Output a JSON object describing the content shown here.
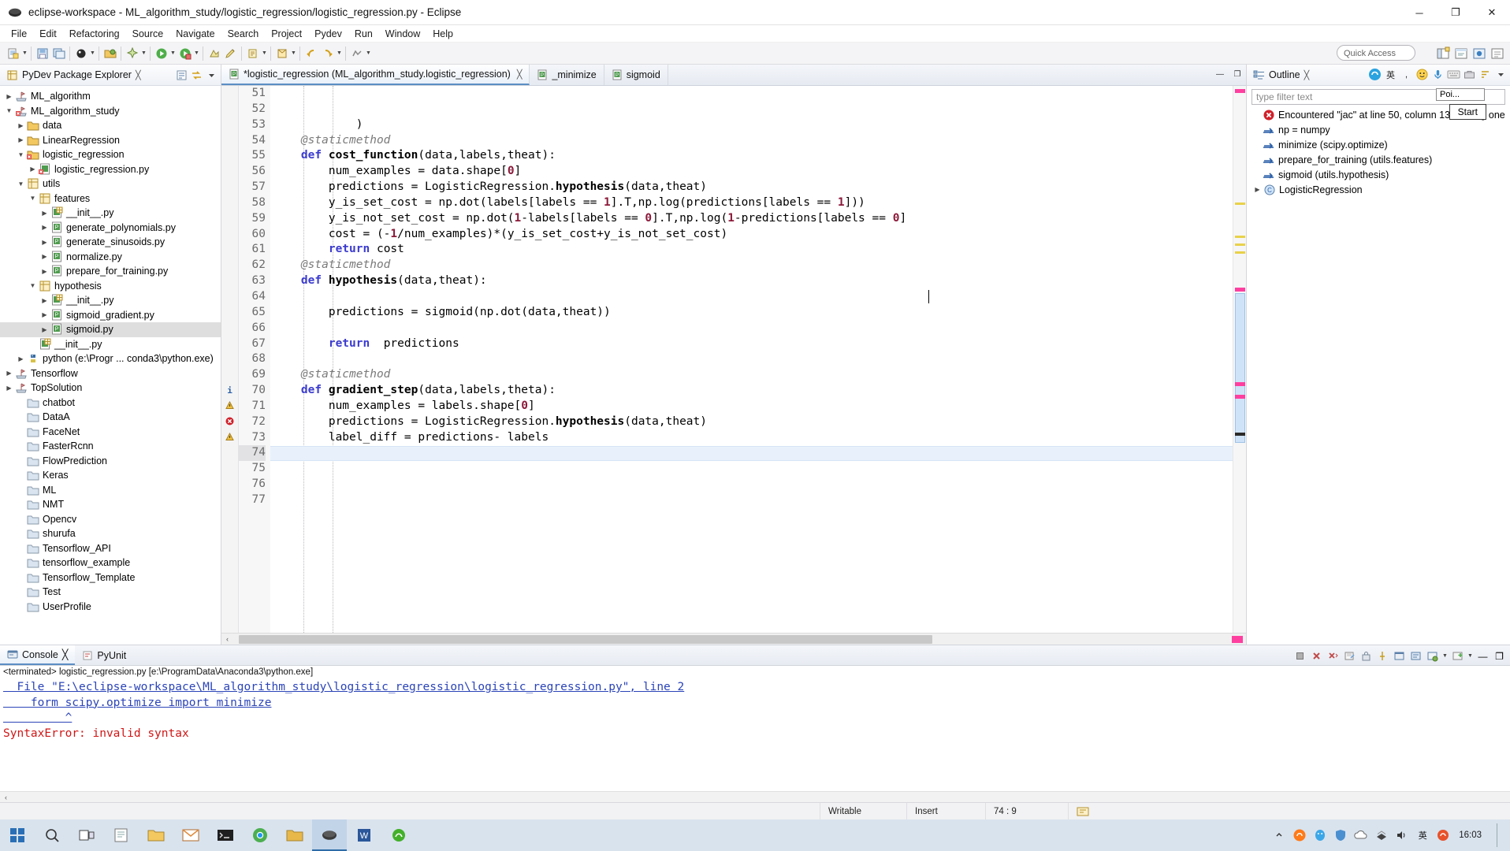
{
  "window": {
    "title": "eclipse-workspace - ML_algorithm_study/logistic_regression/logistic_regression.py - Eclipse",
    "minimize": "─",
    "maximize": "❐",
    "close": "✕"
  },
  "menu": [
    "File",
    "Edit",
    "Refactoring",
    "Source",
    "Navigate",
    "Search",
    "Project",
    "Pydev",
    "Run",
    "Window",
    "Help"
  ],
  "toolbar": {
    "quick_access_placeholder": "Quick Access"
  },
  "explorer": {
    "tab_label": "PyDev Package Explorer",
    "tab_close": "╳",
    "tree": [
      {
        "label": "ML_algorithm",
        "indent": 0,
        "arrow": "collapsed",
        "icon": "project-icon",
        "selected": false
      },
      {
        "label": "ML_algorithm_study",
        "indent": 0,
        "arrow": "expanded",
        "icon": "project-error-icon",
        "selected": false
      },
      {
        "label": "data",
        "indent": 1,
        "arrow": "collapsed",
        "icon": "folder-icon",
        "selected": false
      },
      {
        "label": "LinearRegression",
        "indent": 1,
        "arrow": "collapsed",
        "icon": "folder-icon",
        "selected": false
      },
      {
        "label": "logistic_regression",
        "indent": 1,
        "arrow": "expanded",
        "icon": "folder-error-icon",
        "selected": false
      },
      {
        "label": "logistic_regression.py",
        "indent": 2,
        "arrow": "collapsed",
        "icon": "py-error-icon",
        "selected": false
      },
      {
        "label": "utils",
        "indent": 1,
        "arrow": "expanded",
        "icon": "package-icon",
        "selected": false
      },
      {
        "label": "features",
        "indent": 2,
        "arrow": "expanded",
        "icon": "package-icon",
        "selected": false
      },
      {
        "label": "__init__.py",
        "indent": 3,
        "arrow": "collapsed",
        "icon": "pyinit-icon",
        "selected": false
      },
      {
        "label": "generate_polynomials.py",
        "indent": 3,
        "arrow": "collapsed",
        "icon": "py-icon",
        "selected": false
      },
      {
        "label": "generate_sinusoids.py",
        "indent": 3,
        "arrow": "collapsed",
        "icon": "py-icon",
        "selected": false
      },
      {
        "label": "normalize.py",
        "indent": 3,
        "arrow": "collapsed",
        "icon": "py-icon",
        "selected": false
      },
      {
        "label": "prepare_for_training.py",
        "indent": 3,
        "arrow": "collapsed",
        "icon": "py-icon",
        "selected": false
      },
      {
        "label": "hypothesis",
        "indent": 2,
        "arrow": "expanded",
        "icon": "package-icon",
        "selected": false
      },
      {
        "label": "__init__.py",
        "indent": 3,
        "arrow": "collapsed",
        "icon": "pyinit-icon",
        "selected": false
      },
      {
        "label": "sigmoid_gradient.py",
        "indent": 3,
        "arrow": "collapsed",
        "icon": "py-icon",
        "selected": false
      },
      {
        "label": "sigmoid.py",
        "indent": 3,
        "arrow": "collapsed",
        "icon": "py-icon",
        "selected": true
      },
      {
        "label": "__init__.py",
        "indent": 2,
        "arrow": "none",
        "icon": "pyinit-icon",
        "selected": false
      },
      {
        "label": "python  (e:\\Progr ... conda3\\python.exe)",
        "indent": 1,
        "arrow": "collapsed",
        "icon": "python-icon",
        "selected": false
      },
      {
        "label": "Tensorflow",
        "indent": 0,
        "arrow": "collapsed",
        "icon": "project-icon",
        "selected": false
      },
      {
        "label": "TopSolution",
        "indent": 0,
        "arrow": "collapsed",
        "icon": "project-icon",
        "selected": false
      },
      {
        "label": "chatbot",
        "indent": 1,
        "arrow": "none",
        "icon": "folder-plain-icon",
        "selected": false
      },
      {
        "label": "DataA",
        "indent": 1,
        "arrow": "none",
        "icon": "folder-plain-icon",
        "selected": false
      },
      {
        "label": "FaceNet",
        "indent": 1,
        "arrow": "none",
        "icon": "folder-plain-icon",
        "selected": false
      },
      {
        "label": "FasterRcnn",
        "indent": 1,
        "arrow": "none",
        "icon": "folder-plain-icon",
        "selected": false
      },
      {
        "label": "FlowPrediction",
        "indent": 1,
        "arrow": "none",
        "icon": "folder-plain-icon",
        "selected": false
      },
      {
        "label": "Keras",
        "indent": 1,
        "arrow": "none",
        "icon": "folder-plain-icon",
        "selected": false
      },
      {
        "label": "ML",
        "indent": 1,
        "arrow": "none",
        "icon": "folder-plain-icon",
        "selected": false
      },
      {
        "label": "NMT",
        "indent": 1,
        "arrow": "none",
        "icon": "folder-plain-icon",
        "selected": false
      },
      {
        "label": "Opencv",
        "indent": 1,
        "arrow": "none",
        "icon": "folder-plain-icon",
        "selected": false
      },
      {
        "label": "shurufa",
        "indent": 1,
        "arrow": "none",
        "icon": "folder-plain-icon",
        "selected": false
      },
      {
        "label": "Tensorflow_API",
        "indent": 1,
        "arrow": "none",
        "icon": "folder-plain-icon",
        "selected": false
      },
      {
        "label": "tensorflow_example",
        "indent": 1,
        "arrow": "none",
        "icon": "folder-plain-icon",
        "selected": false
      },
      {
        "label": "Tensorflow_Template",
        "indent": 1,
        "arrow": "none",
        "icon": "folder-plain-icon",
        "selected": false
      },
      {
        "label": "Test",
        "indent": 1,
        "arrow": "none",
        "icon": "folder-plain-icon",
        "selected": false
      },
      {
        "label": "UserProfile",
        "indent": 1,
        "arrow": "none",
        "icon": "folder-plain-icon",
        "selected": false
      }
    ]
  },
  "editor": {
    "tabs": [
      {
        "label": "*logistic_regression (ML_algorithm_study.logistic_regression)",
        "active": true,
        "closable": true
      },
      {
        "label": "_minimize",
        "active": false,
        "closable": false
      },
      {
        "label": "sigmoid",
        "active": false,
        "closable": false
      }
    ],
    "tab_close": "╳",
    "first_line_number": 51,
    "current_line": 74,
    "lines": [
      {
        "n": 51,
        "text": "",
        "marker": "",
        "fold": false
      },
      {
        "n": 52,
        "text": "",
        "marker": "",
        "fold": false
      },
      {
        "n": 53,
        "text": "            )",
        "marker": "",
        "fold": false
      },
      {
        "n": 54,
        "text": "    @staticmethod",
        "marker": "",
        "fold": false
      },
      {
        "n": 55,
        "text": "    def cost_function(data,labels,theat):",
        "marker": "",
        "fold": true
      },
      {
        "n": 56,
        "text": "        num_examples = data.shape[0]",
        "marker": "",
        "fold": false
      },
      {
        "n": 57,
        "text": "        predictions = LogisticRegression.hypothesis(data,theat)",
        "marker": "",
        "fold": false
      },
      {
        "n": 58,
        "text": "        y_is_set_cost = np.dot(labels[labels == 1].T,np.log(predictions[labels == 1]))",
        "marker": "",
        "fold": false
      },
      {
        "n": 59,
        "text": "        y_is_not_set_cost = np.dot(1-labels[labels == 0].T,np.log(1-predictions[labels == 0]",
        "marker": "",
        "fold": false
      },
      {
        "n": 60,
        "text": "        cost = (-1/num_examples)*(y_is_set_cost+y_is_not_set_cost)",
        "marker": "",
        "fold": false
      },
      {
        "n": 61,
        "text": "        return cost",
        "marker": "",
        "fold": false
      },
      {
        "n": 62,
        "text": "    @staticmethod",
        "marker": "",
        "fold": false
      },
      {
        "n": 63,
        "text": "    def hypothesis(data,theat):",
        "marker": "",
        "fold": true
      },
      {
        "n": 64,
        "text": "",
        "marker": "",
        "fold": false
      },
      {
        "n": 65,
        "text": "        predictions = sigmoid(np.dot(data,theat))",
        "marker": "",
        "fold": false
      },
      {
        "n": 66,
        "text": "",
        "marker": "",
        "fold": false
      },
      {
        "n": 67,
        "text": "        return  predictions",
        "marker": "",
        "fold": false
      },
      {
        "n": 68,
        "text": "",
        "marker": "",
        "fold": false
      },
      {
        "n": 69,
        "text": "    @staticmethod",
        "marker": "",
        "fold": false
      },
      {
        "n": 70,
        "text": "    def gradient_step(data,labels,theta):",
        "marker": "info",
        "fold": true
      },
      {
        "n": 71,
        "text": "        num_examples = labels.shape[0]",
        "marker": "warning",
        "fold": false
      },
      {
        "n": 72,
        "text": "        predictions = LogisticRegression.hypothesis(data,theat)",
        "marker": "error",
        "fold": false
      },
      {
        "n": 73,
        "text": "        label_diff = predictions- labels",
        "marker": "warning",
        "fold": false
      },
      {
        "n": 74,
        "text": "",
        "marker": "",
        "fold": false
      },
      {
        "n": 75,
        "text": "",
        "marker": "",
        "fold": false
      },
      {
        "n": 76,
        "text": "",
        "marker": "",
        "fold": false
      },
      {
        "n": 77,
        "text": "",
        "marker": "",
        "fold": false
      }
    ]
  },
  "outline": {
    "tab_label": "Outline",
    "tab_close": "╳",
    "filter_placeholder": "type filter text",
    "items": [
      {
        "label": "Encountered \"jac\" at line 50, column 13. Was",
        "label_tail": "ng one",
        "icon": "error-icon"
      },
      {
        "label": "np = numpy",
        "icon": "import-icon"
      },
      {
        "label": "minimize (scipy.optimize)",
        "icon": "import-icon"
      },
      {
        "label": "prepare_for_training (utils.features)",
        "icon": "import-icon"
      },
      {
        "label": "sigmoid (utils.hypothesis)",
        "icon": "import-icon"
      },
      {
        "label": "LogisticRegression",
        "icon": "class-icon",
        "arrow": "collapsed"
      }
    ],
    "popup_hint": "Poi...",
    "popup_button": "Start"
  },
  "console": {
    "tabs": [
      {
        "label": "Console",
        "active": true,
        "closable": true
      },
      {
        "label": "PyUnit",
        "active": false,
        "closable": false
      }
    ],
    "tab_close": "╳",
    "terminated_line": "<terminated> logistic_regression.py [e:\\ProgramData\\Anaconda3\\python.exe]",
    "output": [
      {
        "text": "  File \"E:\\eclipse-workspace\\ML_algorithm_study\\logistic_regression\\logistic_regression.py\", line 2",
        "style": "link"
      },
      {
        "text": "    form scipy.optimize import minimize",
        "style": "link"
      },
      {
        "text": "         ^",
        "style": "link"
      },
      {
        "text": "SyntaxError: invalid syntax",
        "style": "error"
      }
    ]
  },
  "statusbar": {
    "writable": "Writable",
    "insert": "Insert",
    "position": "74 : 9"
  },
  "taskbar": {
    "clock_time": "16:03",
    "clock_date": ""
  },
  "colors": {
    "accent": "#5b8ec4",
    "error": "#d01616",
    "link": "#2b44b8",
    "selection": "#dedede",
    "current_line": "#e8f1fb"
  }
}
